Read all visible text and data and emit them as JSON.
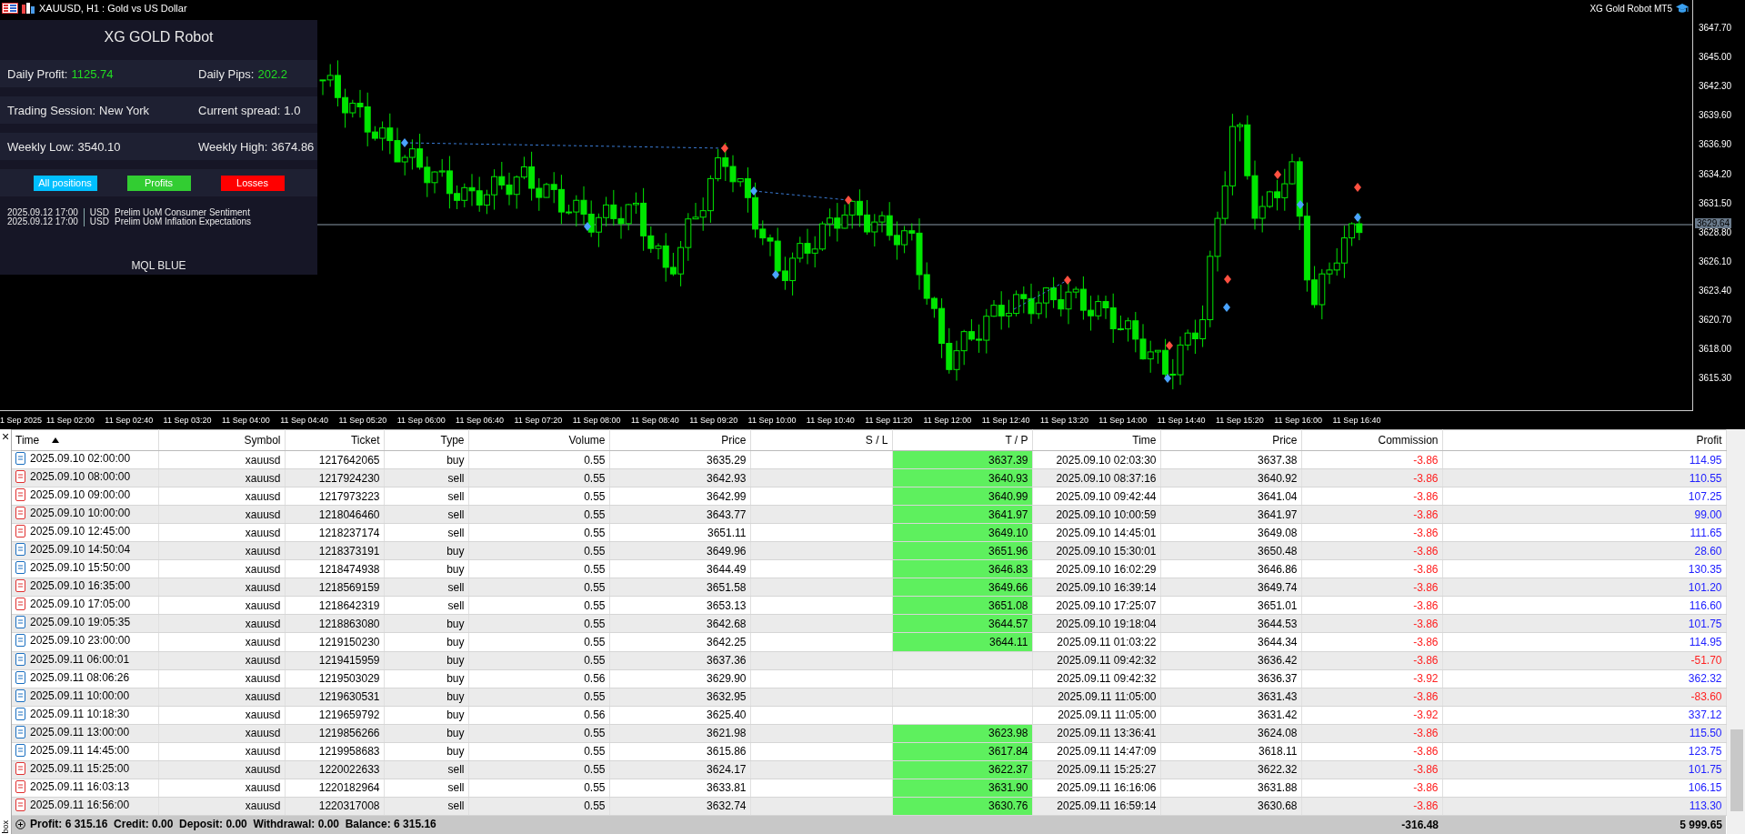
{
  "chart": {
    "title": "XAUUSD, H1 : Gold vs US Dollar",
    "expert": "XG Gold Robot MT5",
    "current_price": "3629.64",
    "price_labels": [
      "3647.70",
      "3645.00",
      "3642.30",
      "3639.60",
      "3636.90",
      "3634.20",
      "3631.50",
      "3628.80",
      "3626.10",
      "3623.40",
      "3620.70",
      "3618.00",
      "3615.30"
    ],
    "time_labels": [
      "1 Sep 2025",
      "11 Sep 02:00",
      "11 Sep 02:40",
      "11 Sep 03:20",
      "11 Sep 04:00",
      "11 Sep 04:40",
      "11 Sep 05:20",
      "11 Sep 06:00",
      "11 Sep 06:40",
      "11 Sep 07:20",
      "11 Sep 08:00",
      "11 Sep 08:40",
      "11 Sep 09:20",
      "11 Sep 10:00",
      "11 Sep 10:40",
      "11 Sep 11:20",
      "11 Sep 12:00",
      "11 Sep 12:40",
      "11 Sep 13:20",
      "11 Sep 14:00",
      "11 Sep 14:40",
      "11 Sep 15:20",
      "11 Sep 16:00",
      "11 Sep 16:40"
    ]
  },
  "panel": {
    "title": "XG GOLD Robot",
    "stats": [
      [
        {
          "label": "Daily Profit:",
          "value": "1125.74",
          "highlight": true
        },
        {
          "label": "Daily Pips:",
          "value": "202.2",
          "highlight": true
        }
      ],
      [
        {
          "label": "Trading Session:",
          "value": "New York",
          "highlight": false
        },
        {
          "label": "Current spread:",
          "value": "1.0",
          "highlight": false
        }
      ],
      [
        {
          "label": "Weekly Low:",
          "value": "3540.10",
          "highlight": false
        },
        {
          "label": "Weekly High:",
          "value": "3674.86",
          "highlight": false
        }
      ]
    ],
    "filters": [
      {
        "label": "All positions",
        "color": "#00bfff"
      },
      {
        "label": "Profits",
        "color": "#32cd32"
      },
      {
        "label": "Losses",
        "color": "#ff0000"
      }
    ],
    "news": [
      {
        "time": "2025.09.12 17:00",
        "currency": "USD",
        "event": "Prelim UoM Consumer Sentiment"
      },
      {
        "time": "2025.09.12 17:00",
        "currency": "USD",
        "event": "Prelim UoM Inflation Expectations"
      }
    ],
    "footer": "MQL BLUE"
  },
  "toolbox": {
    "close": "×",
    "label": "box"
  },
  "table": {
    "columns": [
      {
        "label": "Time",
        "sorted": true
      },
      {
        "label": "Symbol",
        "sorted": false
      },
      {
        "label": "Ticket",
        "sorted": false
      },
      {
        "label": "Type",
        "sorted": false
      },
      {
        "label": "Volume",
        "sorted": false
      },
      {
        "label": "Price",
        "sorted": false
      },
      {
        "label": "S / L",
        "sorted": false
      },
      {
        "label": "T / P",
        "sorted": false
      },
      {
        "label": "Time",
        "sorted": false
      },
      {
        "label": "Price",
        "sorted": false
      },
      {
        "label": "Commission",
        "sorted": false
      },
      {
        "label": "Profit",
        "sorted": false
      }
    ],
    "rows": [
      {
        "time": "2025.09.10 02:00:00",
        "symbol": "xauusd",
        "ticket": "1217642065",
        "kind": "buy",
        "type": "buy",
        "volume": "0.55",
        "price": "3635.29",
        "tp": "3637.39",
        "close_time": "2025.09.10 02:03:30",
        "close_price": "3637.38",
        "commission": "-3.86",
        "profit": "114.95",
        "loss": false
      },
      {
        "time": "2025.09.10 08:00:00",
        "symbol": "xauusd",
        "ticket": "1217924230",
        "kind": "sell",
        "type": "sell",
        "volume": "0.55",
        "price": "3642.93",
        "tp": "3640.93",
        "close_time": "2025.09.10 08:37:16",
        "close_price": "3640.92",
        "commission": "-3.86",
        "profit": "110.55",
        "loss": false
      },
      {
        "time": "2025.09.10 09:00:00",
        "symbol": "xauusd",
        "ticket": "1217973223",
        "kind": "sell",
        "type": "sell",
        "volume": "0.55",
        "price": "3642.99",
        "tp": "3640.99",
        "close_time": "2025.09.10 09:42:44",
        "close_price": "3641.04",
        "commission": "-3.86",
        "profit": "107.25",
        "loss": false
      },
      {
        "time": "2025.09.10 10:00:00",
        "symbol": "xauusd",
        "ticket": "1218046460",
        "kind": "sell",
        "type": "sell",
        "volume": "0.55",
        "price": "3643.77",
        "tp": "3641.97",
        "close_time": "2025.09.10 10:00:59",
        "close_price": "3641.97",
        "commission": "-3.86",
        "profit": "99.00",
        "loss": false
      },
      {
        "time": "2025.09.10 12:45:00",
        "symbol": "xauusd",
        "ticket": "1218237174",
        "kind": "sell",
        "type": "sell",
        "volume": "0.55",
        "price": "3651.11",
        "tp": "3649.10",
        "close_time": "2025.09.10 14:45:01",
        "close_price": "3649.08",
        "commission": "-3.86",
        "profit": "111.65",
        "loss": false
      },
      {
        "time": "2025.09.10 14:50:04",
        "symbol": "xauusd",
        "ticket": "1218373191",
        "kind": "buy",
        "type": "buy",
        "volume": "0.55",
        "price": "3649.96",
        "tp": "3651.96",
        "close_time": "2025.09.10 15:30:01",
        "close_price": "3650.48",
        "commission": "-3.86",
        "profit": "28.60",
        "loss": false
      },
      {
        "time": "2025.09.10 15:50:00",
        "symbol": "xauusd",
        "ticket": "1218474938",
        "kind": "buy",
        "type": "buy",
        "volume": "0.55",
        "price": "3644.49",
        "tp": "3646.83",
        "close_time": "2025.09.10 16:02:29",
        "close_price": "3646.86",
        "commission": "-3.86",
        "profit": "130.35",
        "loss": false
      },
      {
        "time": "2025.09.10 16:35:00",
        "symbol": "xauusd",
        "ticket": "1218569159",
        "kind": "sell",
        "type": "sell",
        "volume": "0.55",
        "price": "3651.58",
        "tp": "3649.66",
        "close_time": "2025.09.10 16:39:14",
        "close_price": "3649.74",
        "commission": "-3.86",
        "profit": "101.20",
        "loss": false
      },
      {
        "time": "2025.09.10 17:05:00",
        "symbol": "xauusd",
        "ticket": "1218642319",
        "kind": "sell",
        "type": "sell",
        "volume": "0.55",
        "price": "3653.13",
        "tp": "3651.08",
        "close_time": "2025.09.10 17:25:07",
        "close_price": "3651.01",
        "commission": "-3.86",
        "profit": "116.60",
        "loss": false
      },
      {
        "time": "2025.09.10 19:05:35",
        "symbol": "xauusd",
        "ticket": "1218863080",
        "kind": "buy",
        "type": "buy",
        "volume": "0.55",
        "price": "3642.68",
        "tp": "3644.57",
        "close_time": "2025.09.10 19:18:04",
        "close_price": "3644.53",
        "commission": "-3.86",
        "profit": "101.75",
        "loss": false
      },
      {
        "time": "2025.09.10 23:00:00",
        "symbol": "xauusd",
        "ticket": "1219150230",
        "kind": "buy",
        "type": "buy",
        "volume": "0.55",
        "price": "3642.25",
        "tp": "3644.11",
        "close_time": "2025.09.11 01:03:22",
        "close_price": "3644.34",
        "commission": "-3.86",
        "profit": "114.95",
        "loss": false
      },
      {
        "time": "2025.09.11 06:00:01",
        "symbol": "xauusd",
        "ticket": "1219415959",
        "kind": "buy",
        "type": "buy",
        "volume": "0.55",
        "price": "3637.36",
        "close_time": "2025.09.11 09:42:32",
        "close_price": "3636.42",
        "commission": "-3.86",
        "profit": "-51.70",
        "loss": true
      },
      {
        "time": "2025.09.11 08:06:26",
        "symbol": "xauusd",
        "ticket": "1219503029",
        "kind": "buy",
        "type": "buy",
        "volume": "0.56",
        "price": "3629.90",
        "close_time": "2025.09.11 09:42:32",
        "close_price": "3636.37",
        "commission": "-3.92",
        "profit": "362.32",
        "loss": false
      },
      {
        "time": "2025.09.11 10:00:00",
        "symbol": "xauusd",
        "ticket": "1219630531",
        "kind": "buy",
        "type": "buy",
        "volume": "0.55",
        "price": "3632.95",
        "close_time": "2025.09.11 11:05:00",
        "close_price": "3631.43",
        "commission": "-3.86",
        "profit": "-83.60",
        "loss": true
      },
      {
        "time": "2025.09.11 10:18:30",
        "symbol": "xauusd",
        "ticket": "1219659792",
        "kind": "buy",
        "type": "buy",
        "volume": "0.56",
        "price": "3625.40",
        "close_time": "2025.09.11 11:05:00",
        "close_price": "3631.42",
        "commission": "-3.92",
        "profit": "337.12",
        "loss": false
      },
      {
        "time": "2025.09.11 13:00:00",
        "symbol": "xauusd",
        "ticket": "1219856266",
        "kind": "buy",
        "type": "buy",
        "volume": "0.55",
        "price": "3621.98",
        "tp": "3623.98",
        "close_time": "2025.09.11 13:36:41",
        "close_price": "3624.08",
        "commission": "-3.86",
        "profit": "115.50",
        "loss": false
      },
      {
        "time": "2025.09.11 14:45:00",
        "symbol": "xauusd",
        "ticket": "1219958683",
        "kind": "buy",
        "type": "buy",
        "volume": "0.55",
        "price": "3615.86",
        "tp": "3617.84",
        "close_time": "2025.09.11 14:47:09",
        "close_price": "3618.11",
        "commission": "-3.86",
        "profit": "123.75",
        "loss": false
      },
      {
        "time": "2025.09.11 15:25:00",
        "symbol": "xauusd",
        "ticket": "1220022633",
        "kind": "sell",
        "type": "sell",
        "volume": "0.55",
        "price": "3624.17",
        "tp": "3622.37",
        "close_time": "2025.09.11 15:25:27",
        "close_price": "3622.32",
        "commission": "-3.86",
        "profit": "101.75",
        "loss": false
      },
      {
        "time": "2025.09.11 16:03:13",
        "symbol": "xauusd",
        "ticket": "1220182964",
        "kind": "sell",
        "type": "sell",
        "volume": "0.55",
        "price": "3633.81",
        "tp": "3631.90",
        "close_time": "2025.09.11 16:16:06",
        "close_price": "3631.88",
        "commission": "-3.86",
        "profit": "106.15",
        "loss": false
      },
      {
        "time": "2025.09.11 16:56:00",
        "symbol": "xauusd",
        "ticket": "1220317008",
        "kind": "sell",
        "type": "sell",
        "volume": "0.55",
        "price": "3632.74",
        "tp": "3630.76",
        "close_time": "2025.09.11 16:59:14",
        "close_price": "3630.68",
        "commission": "-3.86",
        "profit": "113.30",
        "loss": false
      }
    ],
    "summary": "Profit: 6 315.16  Credit: 0.00  Deposit: 0.00  Withdrawal: 0.00  Balance: 6 315.16",
    "total_commission": "-316.48",
    "total_profit": "5 999.65"
  }
}
